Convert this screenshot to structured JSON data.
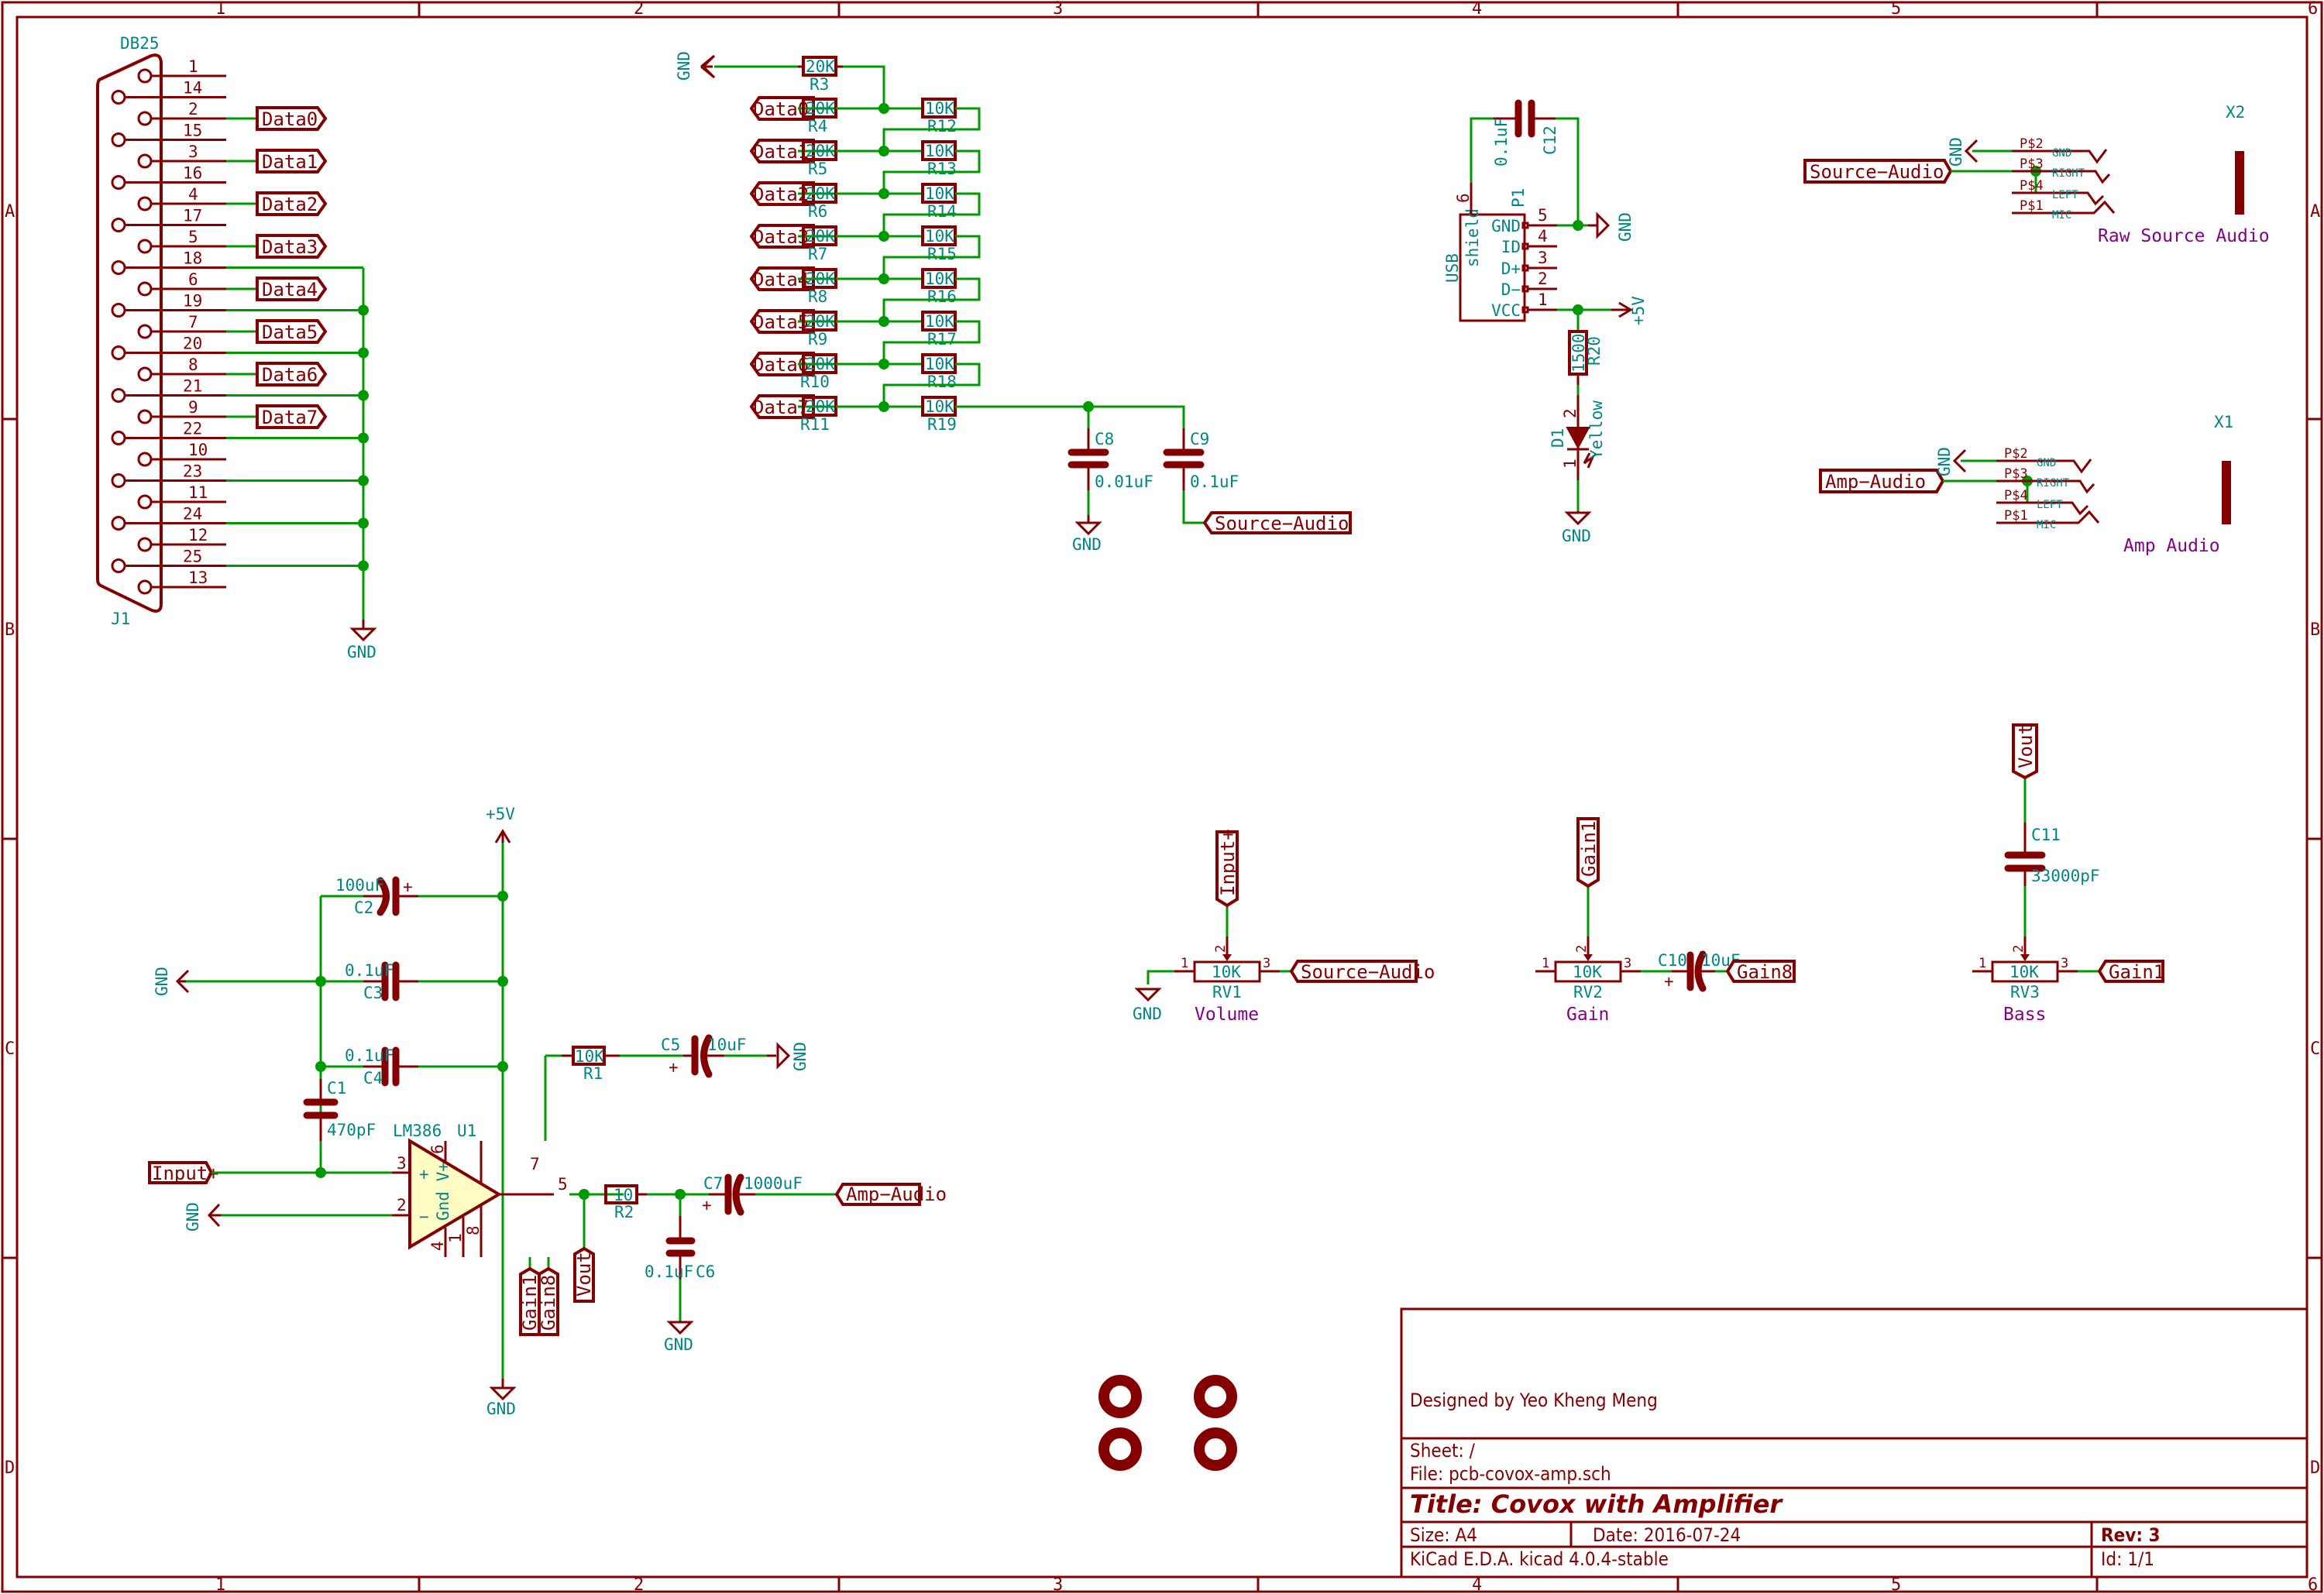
{
  "sheet": {
    "columns": [
      "1",
      "2",
      "3",
      "4",
      "5",
      "6"
    ],
    "rows": [
      "A",
      "B",
      "C",
      "D"
    ]
  },
  "title_block": {
    "designed_by": "Designed by Yeo Kheng Meng",
    "sheet": "Sheet: /",
    "file": "File: pcb-covox-amp.sch",
    "title": "Title: Covox with Amplifier",
    "size": "Size: A4",
    "date": "Date: 2016-07-24",
    "rev": "Rev: 3",
    "tool": "KiCad E.D.A.  kicad 4.0.4-stable",
    "id": "Id: 1/1"
  },
  "connector_j1": {
    "ref": "J1",
    "value": "DB25",
    "pins": [
      "1",
      "14",
      "2",
      "15",
      "3",
      "16",
      "4",
      "17",
      "5",
      "18",
      "6",
      "19",
      "7",
      "20",
      "8",
      "21",
      "9",
      "22",
      "10",
      "23",
      "11",
      "24",
      "12",
      "25",
      "13"
    ],
    "data_labels": [
      "Data0",
      "Data1",
      "Data2",
      "Data3",
      "Data4",
      "Data5",
      "Data6",
      "Data7"
    ],
    "gnd": "GND"
  },
  "r2r_ladder": {
    "gnd": "GND",
    "r_top": {
      "ref": "R3",
      "value": "20K"
    },
    "inputs": [
      "Data0",
      "Data1",
      "Data2",
      "Data3",
      "Data4",
      "Data5",
      "Data6",
      "Data7"
    ],
    "r20k": [
      {
        "ref": "R4",
        "value": "20K"
      },
      {
        "ref": "R5",
        "value": "20K"
      },
      {
        "ref": "R6",
        "value": "20K"
      },
      {
        "ref": "R7",
        "value": "20K"
      },
      {
        "ref": "R8",
        "value": "20K"
      },
      {
        "ref": "R9",
        "value": "20K"
      },
      {
        "ref": "R10",
        "value": "20K"
      },
      {
        "ref": "R11",
        "value": "20K"
      }
    ],
    "r10k": [
      {
        "ref": "R12",
        "value": "10K"
      },
      {
        "ref": "R13",
        "value": "10K"
      },
      {
        "ref": "R14",
        "value": "10K"
      },
      {
        "ref": "R15",
        "value": "10K"
      },
      {
        "ref": "R16",
        "value": "10K"
      },
      {
        "ref": "R17",
        "value": "10K"
      },
      {
        "ref": "R18",
        "value": "10K"
      },
      {
        "ref": "R19",
        "value": "10K"
      }
    ],
    "c8": {
      "ref": "C8",
      "value": "0.01uF"
    },
    "c9": {
      "ref": "C9",
      "value": "0.1uF"
    },
    "gnd_bottom": "GND",
    "out_label": "Source−Audio"
  },
  "usb": {
    "ref": "P1",
    "name": "USB",
    "shield": "shield",
    "shield_pin": "6",
    "pins": [
      {
        "num": "5",
        "name": "GND"
      },
      {
        "num": "4",
        "name": "ID"
      },
      {
        "num": "3",
        "name": "D+"
      },
      {
        "num": "2",
        "name": "D−"
      },
      {
        "num": "1",
        "name": "VCC"
      }
    ],
    "c12": {
      "ref": "C12",
      "value": "0.1uF"
    },
    "gnd": "GND",
    "vcc": "+5V",
    "r20": {
      "ref": "R20",
      "value": "1500"
    },
    "d1": {
      "ref": "D1",
      "value": "Yellow",
      "pin_a": "2",
      "pin_k": "1"
    },
    "gnd_bottom": "GND"
  },
  "jack_x2": {
    "ref": "X2",
    "name": "Raw Source Audio",
    "label": "Source−Audio",
    "gnd": "GND",
    "pins": [
      {
        "num": "P$2",
        "name": "GND"
      },
      {
        "num": "P$3",
        "name": "RIGHT"
      },
      {
        "num": "P$4",
        "name": "LEFT"
      },
      {
        "num": "P$1",
        "name": "MIC"
      }
    ]
  },
  "jack_x1": {
    "ref": "X1",
    "name": "Amp Audio",
    "label": "Amp−Audio",
    "gnd": "GND",
    "pins": [
      {
        "num": "P$2",
        "name": "GND"
      },
      {
        "num": "P$3",
        "name": "RIGHT"
      },
      {
        "num": "P$4",
        "name": "LEFT"
      },
      {
        "num": "P$1",
        "name": "MIC"
      }
    ]
  },
  "amplifier": {
    "vcc": "+5V",
    "gnd_left": "GND",
    "c2": {
      "ref": "C2",
      "value": "100uF"
    },
    "c3": {
      "ref": "C3",
      "value": "0.1uF"
    },
    "c4": {
      "ref": "C4",
      "value": "0.1uF"
    },
    "c1": {
      "ref": "C1",
      "value": "470pF"
    },
    "u1": {
      "ref": "U1",
      "value": "LM386",
      "plus": "+",
      "minus": "−",
      "inner": "Gnd V+"
    },
    "u1_pins": {
      "p3": "3",
      "p2": "2",
      "p6": "6",
      "p4": "4",
      "p7": "7",
      "p1": "1",
      "p8": "8",
      "p5": "5"
    },
    "input_label": "Input+",
    "gnd_minus": "GND",
    "gain1": "Gain1",
    "gain8": "Gain8",
    "gnd_bottom": "GND",
    "r1": {
      "ref": "R1",
      "value": "10K"
    },
    "c5": {
      "ref": "C5",
      "value": "10uF"
    },
    "gnd_c5": "GND",
    "vout": "Vout",
    "r2": {
      "ref": "R2",
      "value": "10"
    },
    "c6": {
      "ref": "C6",
      "value": "0.1uF"
    },
    "gnd_c6": "GND",
    "c7": {
      "ref": "C7",
      "value": "1000uF"
    },
    "out_label": "Amp−Audio"
  },
  "pots": [
    {
      "ref": "RV1",
      "value": "10K",
      "name": "Volume",
      "top_label": "Input+",
      "right_label": "Source−Audio",
      "left": "GND",
      "p1": "1",
      "p2": "2",
      "p3": "3"
    },
    {
      "ref": "RV2",
      "value": "10K",
      "name": "Gain",
      "top_label": "Gain1",
      "right_label": "Gain8",
      "p1": "1",
      "p2": "2",
      "p3": "3",
      "cap": {
        "ref": "C10",
        "value": "10uF"
      }
    },
    {
      "ref": "RV3",
      "value": "10K",
      "name": "Bass",
      "top_label": "Vout",
      "right_label": "Gain1",
      "p1": "1",
      "p2": "2",
      "p3": "3",
      "cap": {
        "ref": "C11",
        "value": "33000pF"
      }
    }
  ],
  "plus_sign": "+"
}
